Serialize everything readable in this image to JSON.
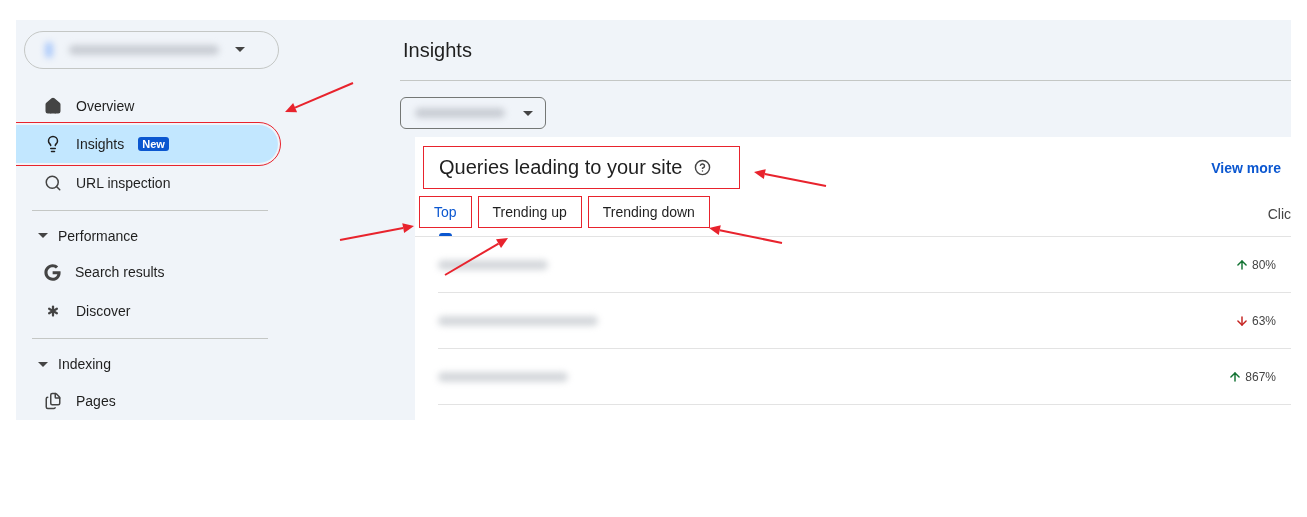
{
  "sidebar": {
    "items": [
      {
        "kind": "item",
        "label": "Overview",
        "selected": false,
        "annotated": false
      },
      {
        "kind": "item",
        "label": "Insights",
        "badge": "New",
        "selected": true,
        "annotated": true
      },
      {
        "kind": "item",
        "label": "URL inspection",
        "selected": false,
        "annotated": false
      },
      {
        "kind": "divider"
      },
      {
        "kind": "section",
        "label": "Performance",
        "expanded": true
      },
      {
        "kind": "item",
        "label": "Search results",
        "selected": false,
        "annotated": false
      },
      {
        "kind": "item",
        "label": "Discover",
        "selected": false,
        "annotated": false
      },
      {
        "kind": "divider"
      },
      {
        "kind": "section",
        "label": "Indexing",
        "expanded": true
      },
      {
        "kind": "item",
        "label": "Pages",
        "selected": false,
        "annotated": false
      }
    ]
  },
  "page_title": "Insights",
  "card": {
    "title": "Queries leading to your site",
    "title_annotated": true,
    "link": "View more",
    "tabs": [
      {
        "label": "Top",
        "selected": true,
        "annotated": true
      },
      {
        "label": "Trending up",
        "selected": false,
        "annotated": true
      },
      {
        "label": "Trending down",
        "selected": false,
        "annotated": true
      }
    ],
    "column_header": "Clic",
    "rows": [
      {
        "kind": "up",
        "change": "80%"
      },
      {
        "kind": "down",
        "change": "63%"
      },
      {
        "kind": "up",
        "change": "867%"
      }
    ]
  }
}
